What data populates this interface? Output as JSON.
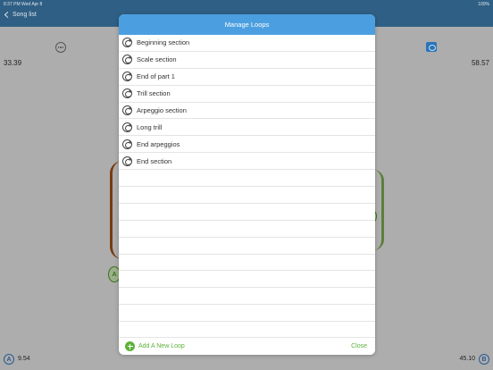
{
  "status": {
    "time": "8:37 PM",
    "date": "Wed Apr 8",
    "battery": "100%"
  },
  "nav": {
    "back_label": "Song list"
  },
  "player": {
    "start_time": "33.39",
    "end_time": "58.57",
    "a_label": "A",
    "a_value": "9.54",
    "b_label": "B",
    "b_value": "45.10"
  },
  "modal": {
    "title": "Manage Loops",
    "loops": [
      {
        "label": "Beginning section"
      },
      {
        "label": "Scale section"
      },
      {
        "label": "End of part 1"
      },
      {
        "label": "Trill section"
      },
      {
        "label": "Arpeggio section"
      },
      {
        "label": "Long trill"
      },
      {
        "label": "End arpeggios"
      },
      {
        "label": "End section"
      }
    ],
    "add_label": "Add A New Loop",
    "close_label": "Close"
  },
  "colors": {
    "accent": "#4b9fe0",
    "green": "#5cb23a",
    "nav": "#2f5f84"
  }
}
